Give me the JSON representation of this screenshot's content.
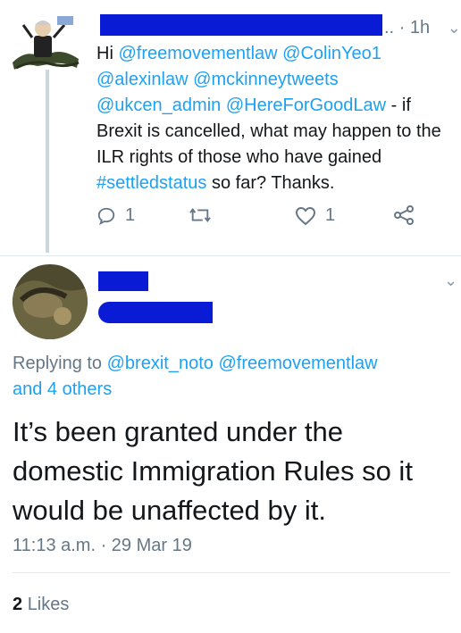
{
  "tweet": {
    "time": "1h",
    "handle_suffix": "..",
    "text_parts": [
      {
        "text": "Hi ",
        "type": "text"
      },
      {
        "text": "@freemovementlaw",
        "type": "link"
      },
      {
        "text": " ",
        "type": "text"
      },
      {
        "text": "@ColinYeo1",
        "type": "link"
      },
      {
        "text": " ",
        "type": "text"
      },
      {
        "text": "@alexinlaw",
        "type": "link"
      },
      {
        "text": " ",
        "type": "text"
      },
      {
        "text": "@mckinneytweets",
        "type": "link"
      },
      {
        "text": " ",
        "type": "text"
      },
      {
        "text": "@ukcen_admin",
        "type": "link"
      },
      {
        "text": " ",
        "type": "text"
      },
      {
        "text": "@HereForGoodLaw",
        "type": "link"
      },
      {
        "text": " - if Brexit is cancelled, what may happen to the ILR rights of those who have gained ",
        "type": "text"
      },
      {
        "text": "#settledstatus",
        "type": "link"
      },
      {
        "text": " so far? Thanks.",
        "type": "text"
      }
    ],
    "reply_count": "1",
    "like_count": "1"
  },
  "reply": {
    "replying_prefix": "Replying to ",
    "replying_user1": "@brexit_noto",
    "replying_user2": "@freemovementlaw",
    "replying_others": "and 4 others",
    "text": "It’s been granted under the domestic Immigration Rules so it would be unaffected by it.",
    "timestamp": "11:13 a.m. · 29 Mar 19",
    "likes_count": "2",
    "likes_label": "Likes"
  },
  "icons": {
    "reply": "reply-icon",
    "retweet": "retweet-icon",
    "like": "heart-icon",
    "share": "share-icon",
    "more": "chevron-down-icon"
  },
  "colors": {
    "link": "#1da1f2",
    "muted": "#657786",
    "redaction": "#0a1bd6"
  }
}
